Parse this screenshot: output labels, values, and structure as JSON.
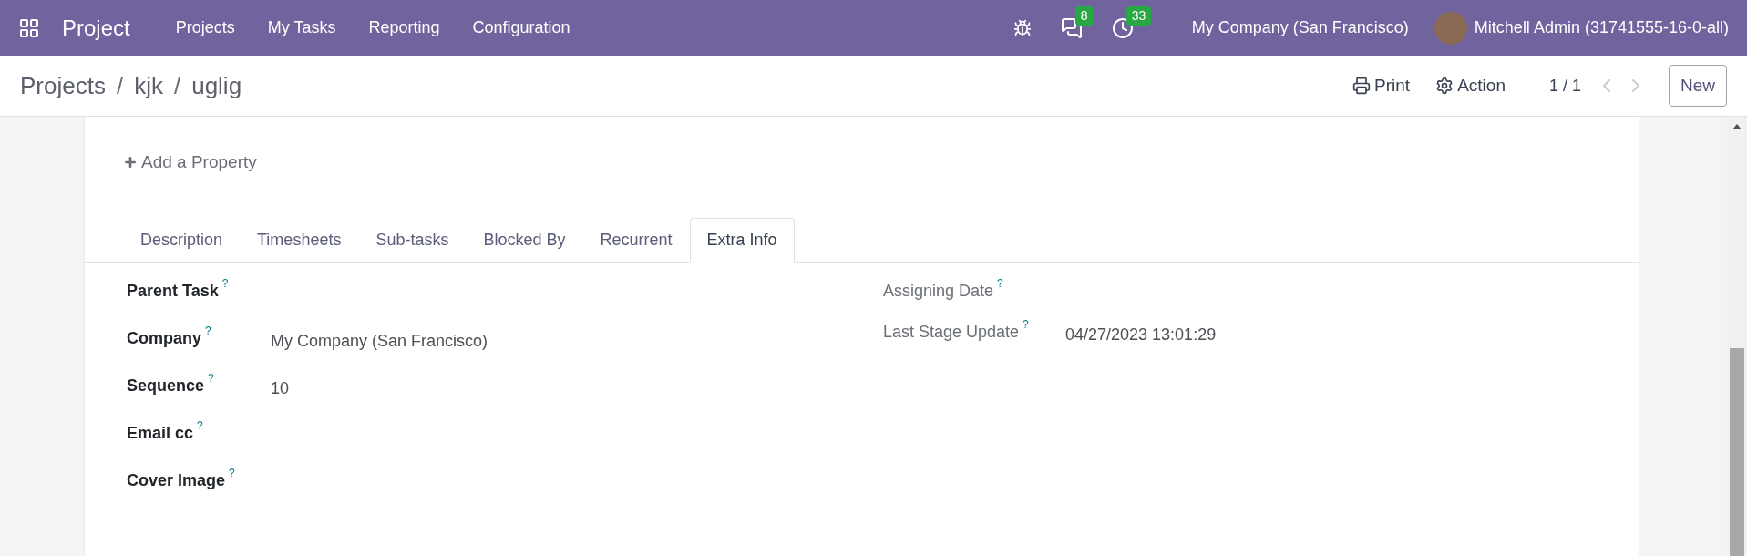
{
  "navbar": {
    "app_name": "Project",
    "menu": [
      "Projects",
      "My Tasks",
      "Reporting",
      "Configuration"
    ],
    "messages_count": "8",
    "activities_count": "33",
    "company": "My Company (San Francisco)",
    "user": "Mitchell Admin (31741555-16-0-all)"
  },
  "control_panel": {
    "breadcrumb": [
      {
        "label": "Projects"
      },
      {
        "separator": "/",
        "label": "kjk"
      },
      {
        "separator": "/",
        "label": "uglig"
      }
    ],
    "print": "Print",
    "action": "Action",
    "pager": "1 / 1",
    "new": "New"
  },
  "add_property": "Add a Property",
  "tabs": [
    {
      "label": "Description",
      "selected": false
    },
    {
      "label": "Timesheets",
      "selected": false
    },
    {
      "label": "Sub-tasks",
      "selected": false
    },
    {
      "label": "Blocked By",
      "selected": false
    },
    {
      "label": "Recurrent",
      "selected": false
    },
    {
      "label": "Extra Info",
      "selected": true
    }
  ],
  "left_fields": [
    {
      "label": "Parent Task",
      "help": "?",
      "readonly": false
    },
    {
      "label": "Company",
      "help": "?",
      "value": "My Company (San Francisco)",
      "readonly": false
    },
    {
      "label": "Sequence",
      "help": "?",
      "value": "10",
      "readonly": false
    },
    {
      "label": "Email cc",
      "help": "?",
      "readonly": false
    },
    {
      "label": "Cover Image",
      "help": "?",
      "readonly": false
    }
  ],
  "right_fields": [
    {
      "label": "Assigning Date",
      "help": "?",
      "readonly": true
    },
    {
      "label": "Last Stage Update",
      "help": "?",
      "value": "04/27/2023 13:01:29",
      "readonly": true
    }
  ]
}
